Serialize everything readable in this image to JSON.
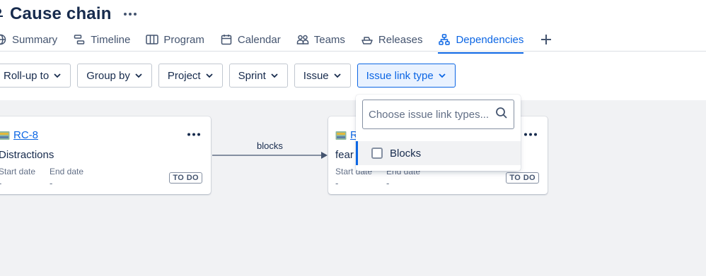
{
  "project": {
    "title": "Cause chain"
  },
  "tabs": [
    {
      "label": "Summary",
      "icon": "globe-icon"
    },
    {
      "label": "Timeline",
      "icon": "timeline-icon"
    },
    {
      "label": "Program",
      "icon": "board-icon"
    },
    {
      "label": "Calendar",
      "icon": "calendar-icon"
    },
    {
      "label": "Teams",
      "icon": "people-icon"
    },
    {
      "label": "Releases",
      "icon": "ship-icon"
    },
    {
      "label": "Dependencies",
      "icon": "hierarchy-icon",
      "active": true
    }
  ],
  "filters": [
    {
      "label": "Roll-up to"
    },
    {
      "label": "Group by"
    },
    {
      "label": "Project"
    },
    {
      "label": "Sprint"
    },
    {
      "label": "Issue"
    },
    {
      "label": "Issue link type",
      "active": true
    }
  ],
  "cards": [
    {
      "key": "RC-8",
      "summary": "Distractions",
      "start_label": "Start date",
      "start_value": "-",
      "end_label": "End date",
      "end_value": "-",
      "status": "TO DO"
    },
    {
      "key": "R",
      "summary": "fear",
      "start_label": "Start date",
      "start_value": "-",
      "end_label": "End date",
      "end_value": "-",
      "status": "TO DO"
    }
  ],
  "connector": {
    "label": "blocks"
  },
  "dropdown": {
    "placeholder": "Choose issue link types...",
    "options": [
      {
        "label": "Blocks",
        "checked": false
      }
    ]
  },
  "colors": {
    "accent": "#0c66e4",
    "canvas": "#f1f2f4",
    "text": "#172b4d"
  }
}
